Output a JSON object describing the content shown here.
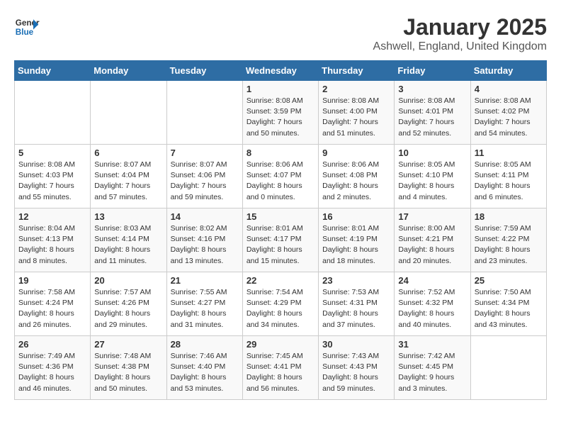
{
  "header": {
    "logo_line1": "General",
    "logo_line2": "Blue",
    "title": "January 2025",
    "subtitle": "Ashwell, England, United Kingdom"
  },
  "weekdays": [
    "Sunday",
    "Monday",
    "Tuesday",
    "Wednesday",
    "Thursday",
    "Friday",
    "Saturday"
  ],
  "weeks": [
    [
      {
        "day": "",
        "info": ""
      },
      {
        "day": "",
        "info": ""
      },
      {
        "day": "",
        "info": ""
      },
      {
        "day": "1",
        "info": "Sunrise: 8:08 AM\nSunset: 3:59 PM\nDaylight: 7 hours\nand 50 minutes."
      },
      {
        "day": "2",
        "info": "Sunrise: 8:08 AM\nSunset: 4:00 PM\nDaylight: 7 hours\nand 51 minutes."
      },
      {
        "day": "3",
        "info": "Sunrise: 8:08 AM\nSunset: 4:01 PM\nDaylight: 7 hours\nand 52 minutes."
      },
      {
        "day": "4",
        "info": "Sunrise: 8:08 AM\nSunset: 4:02 PM\nDaylight: 7 hours\nand 54 minutes."
      }
    ],
    [
      {
        "day": "5",
        "info": "Sunrise: 8:08 AM\nSunset: 4:03 PM\nDaylight: 7 hours\nand 55 minutes."
      },
      {
        "day": "6",
        "info": "Sunrise: 8:07 AM\nSunset: 4:04 PM\nDaylight: 7 hours\nand 57 minutes."
      },
      {
        "day": "7",
        "info": "Sunrise: 8:07 AM\nSunset: 4:06 PM\nDaylight: 7 hours\nand 59 minutes."
      },
      {
        "day": "8",
        "info": "Sunrise: 8:06 AM\nSunset: 4:07 PM\nDaylight: 8 hours\nand 0 minutes."
      },
      {
        "day": "9",
        "info": "Sunrise: 8:06 AM\nSunset: 4:08 PM\nDaylight: 8 hours\nand 2 minutes."
      },
      {
        "day": "10",
        "info": "Sunrise: 8:05 AM\nSunset: 4:10 PM\nDaylight: 8 hours\nand 4 minutes."
      },
      {
        "day": "11",
        "info": "Sunrise: 8:05 AM\nSunset: 4:11 PM\nDaylight: 8 hours\nand 6 minutes."
      }
    ],
    [
      {
        "day": "12",
        "info": "Sunrise: 8:04 AM\nSunset: 4:13 PM\nDaylight: 8 hours\nand 8 minutes."
      },
      {
        "day": "13",
        "info": "Sunrise: 8:03 AM\nSunset: 4:14 PM\nDaylight: 8 hours\nand 11 minutes."
      },
      {
        "day": "14",
        "info": "Sunrise: 8:02 AM\nSunset: 4:16 PM\nDaylight: 8 hours\nand 13 minutes."
      },
      {
        "day": "15",
        "info": "Sunrise: 8:01 AM\nSunset: 4:17 PM\nDaylight: 8 hours\nand 15 minutes."
      },
      {
        "day": "16",
        "info": "Sunrise: 8:01 AM\nSunset: 4:19 PM\nDaylight: 8 hours\nand 18 minutes."
      },
      {
        "day": "17",
        "info": "Sunrise: 8:00 AM\nSunset: 4:21 PM\nDaylight: 8 hours\nand 20 minutes."
      },
      {
        "day": "18",
        "info": "Sunrise: 7:59 AM\nSunset: 4:22 PM\nDaylight: 8 hours\nand 23 minutes."
      }
    ],
    [
      {
        "day": "19",
        "info": "Sunrise: 7:58 AM\nSunset: 4:24 PM\nDaylight: 8 hours\nand 26 minutes."
      },
      {
        "day": "20",
        "info": "Sunrise: 7:57 AM\nSunset: 4:26 PM\nDaylight: 8 hours\nand 29 minutes."
      },
      {
        "day": "21",
        "info": "Sunrise: 7:55 AM\nSunset: 4:27 PM\nDaylight: 8 hours\nand 31 minutes."
      },
      {
        "day": "22",
        "info": "Sunrise: 7:54 AM\nSunset: 4:29 PM\nDaylight: 8 hours\nand 34 minutes."
      },
      {
        "day": "23",
        "info": "Sunrise: 7:53 AM\nSunset: 4:31 PM\nDaylight: 8 hours\nand 37 minutes."
      },
      {
        "day": "24",
        "info": "Sunrise: 7:52 AM\nSunset: 4:32 PM\nDaylight: 8 hours\nand 40 minutes."
      },
      {
        "day": "25",
        "info": "Sunrise: 7:50 AM\nSunset: 4:34 PM\nDaylight: 8 hours\nand 43 minutes."
      }
    ],
    [
      {
        "day": "26",
        "info": "Sunrise: 7:49 AM\nSunset: 4:36 PM\nDaylight: 8 hours\nand 46 minutes."
      },
      {
        "day": "27",
        "info": "Sunrise: 7:48 AM\nSunset: 4:38 PM\nDaylight: 8 hours\nand 50 minutes."
      },
      {
        "day": "28",
        "info": "Sunrise: 7:46 AM\nSunset: 4:40 PM\nDaylight: 8 hours\nand 53 minutes."
      },
      {
        "day": "29",
        "info": "Sunrise: 7:45 AM\nSunset: 4:41 PM\nDaylight: 8 hours\nand 56 minutes."
      },
      {
        "day": "30",
        "info": "Sunrise: 7:43 AM\nSunset: 4:43 PM\nDaylight: 8 hours\nand 59 minutes."
      },
      {
        "day": "31",
        "info": "Sunrise: 7:42 AM\nSunset: 4:45 PM\nDaylight: 9 hours\nand 3 minutes."
      },
      {
        "day": "",
        "info": ""
      }
    ]
  ]
}
